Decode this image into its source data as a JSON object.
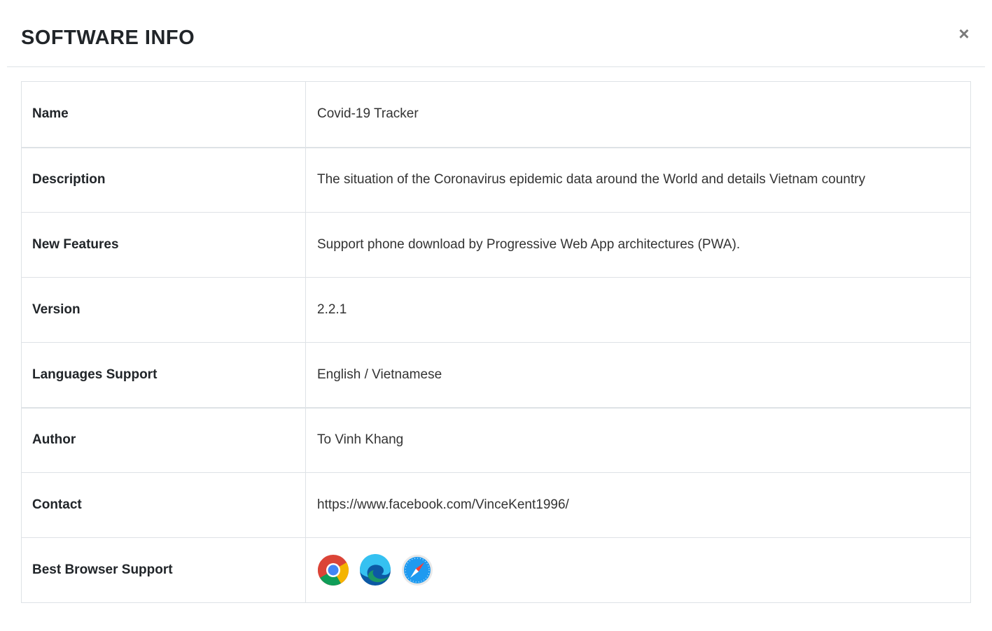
{
  "modal": {
    "title": "SOFTWARE INFO",
    "close_label": "×"
  },
  "rows": [
    {
      "label": "Name",
      "value": "Covid-19 Tracker"
    },
    {
      "label": "Description",
      "value": "The situation of the Coronavirus epidemic data around the World and details Vietnam country"
    },
    {
      "label": "New Features",
      "value": "Support phone download by Progressive Web App architectures (PWA)."
    },
    {
      "label": "Version",
      "value": "2.2.1"
    },
    {
      "label": "Languages Support",
      "value": "English / Vietnamese"
    },
    {
      "label": "Author",
      "value": "To Vinh Khang"
    },
    {
      "label": "Contact",
      "value": "https://www.facebook.com/VinceKent1996/"
    },
    {
      "label": "Best Browser Support",
      "icons": [
        "chrome-icon",
        "edge-icon",
        "safari-icon"
      ]
    }
  ]
}
